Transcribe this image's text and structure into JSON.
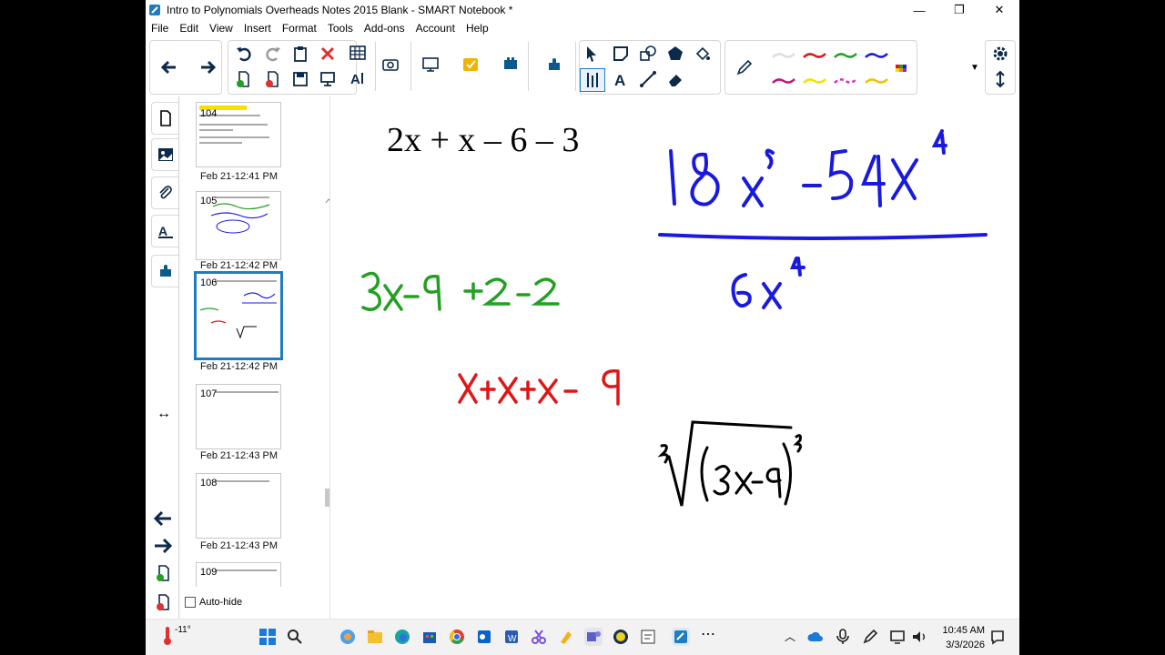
{
  "window": {
    "title": "Intro to Polynomials Overheads Notes 2015 Blank - SMART Notebook *",
    "minimize": "—",
    "restore": "❐",
    "close": "✕"
  },
  "menu": [
    "File",
    "Edit",
    "View",
    "Insert",
    "Format",
    "Tools",
    "Add-ons",
    "Account",
    "Help"
  ],
  "colors": {
    "accent": "#1f7cc1",
    "ink_blue": "#1a1adf",
    "ink_green": "#22a022",
    "ink_red": "#e01515"
  },
  "toolbar": {
    "icons": [
      "back-arrow-icon",
      "forward-arrow-icon",
      "undo-icon",
      "redo-icon",
      "paste-icon",
      "delete-icon",
      "table-icon",
      "add-page-icon",
      "delete-page-icon",
      "save-icon",
      "screen-shade-icon",
      "text-style-icon",
      "screen-capture-icon",
      "display-icon",
      "response-icon",
      "activity-builder-icon",
      "addons-icon",
      "select-icon",
      "shapes-icon",
      "regular-shapes-icon",
      "fill-icon",
      "measurement-icon",
      "text-icon",
      "line-icon",
      "eraser-icon",
      "pen-icon",
      "color-picker-icon",
      "settings-icon",
      "move-toolbar-icon"
    ]
  },
  "sorter": {
    "pages": [
      {
        "number": "104",
        "date": "Feb 21-12:41 PM"
      },
      {
        "number": "105",
        "date": "Feb 21-12:42 PM"
      },
      {
        "number": "106",
        "date": "Feb 21-12:42 PM"
      },
      {
        "number": "107",
        "date": "Feb 21-12:43 PM"
      },
      {
        "number": "108",
        "date": "Feb 21-12:43 PM"
      },
      {
        "number": "109",
        "date": ""
      }
    ],
    "autohide_label": "Auto-hide"
  },
  "canvas": {
    "typed_expression": "2x + x – 6 – 3",
    "ink_green": "3x-9 +2-2",
    "ink_red": "x+x+x-9",
    "ink_fraction_numerator": "18x⁵-54x⁴",
    "ink_fraction_denominator": "6x⁴",
    "ink_root": "∛(3x-9)³"
  },
  "taskbar": {
    "temperature": "-11°",
    "time": "10:45 AM",
    "date": "3/3/2026"
  }
}
